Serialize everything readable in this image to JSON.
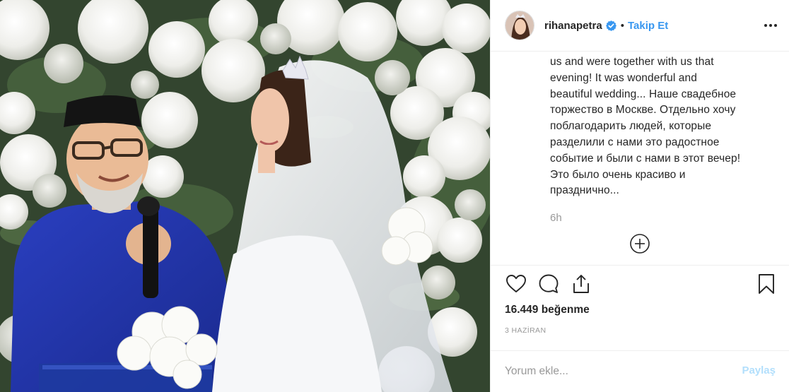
{
  "post": {
    "username": "rihanapetra",
    "follow_label": "Takip Et",
    "separator": "•",
    "caption_lines": [
      "us and were together with us that",
      "evening! It was wonderful and",
      "beautiful wedding... Наше свадебное",
      "торжество в Москве. Отдельно хочу",
      "поблагодарить людей, которые",
      "разделили с нами это радостное",
      "событие и были с нами в этот вечер!",
      "Это было очень красиво и",
      "празднично..."
    ],
    "time_ago": "6h",
    "likes": "16.449 beğenme",
    "date": "3 HAZİRAN",
    "comment_placeholder": "Yorum ekle...",
    "share_label": "Paylaş"
  },
  "colors": {
    "accent": "#3897f0",
    "share_disabled": "#b2dffc",
    "muted": "#999999",
    "text": "#262626"
  },
  "icons": {
    "verified": "verified-badge-icon",
    "more": "more-options-icon",
    "load_more": "plus-circle-icon",
    "like": "heart-icon",
    "comment": "comment-bubble-icon",
    "share": "share-upload-icon",
    "save": "bookmark-icon"
  }
}
